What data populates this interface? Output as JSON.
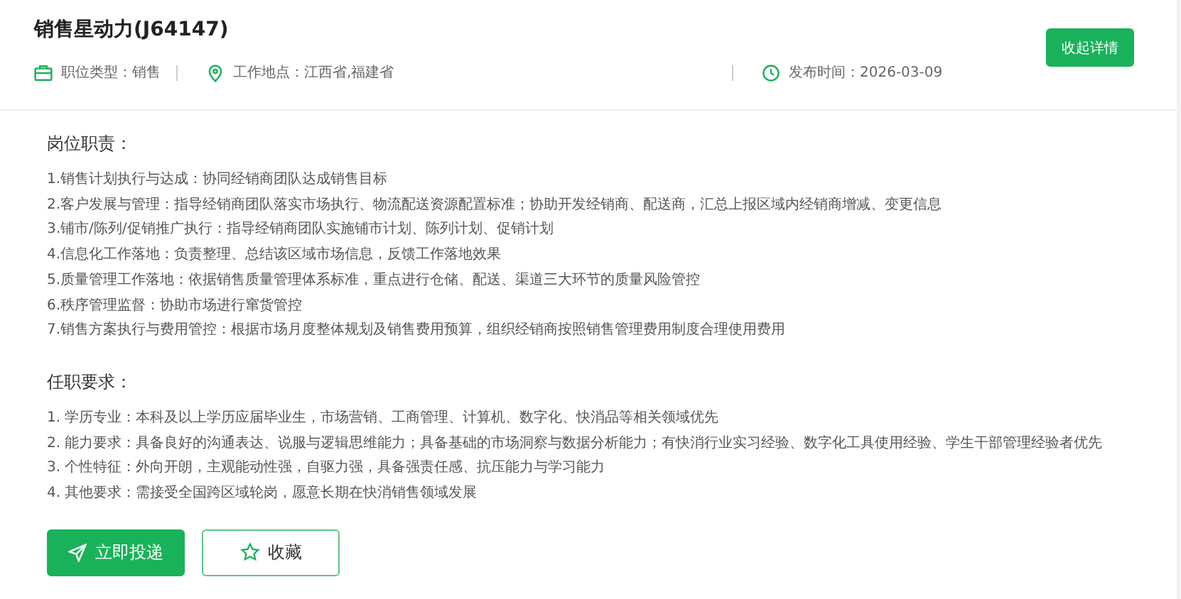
{
  "job": {
    "title": "销售星动力(J64147)",
    "collapse_button": "收起详情",
    "meta": [
      {
        "kind": "category",
        "text": "职位类型：销售"
      },
      {
        "kind": "location",
        "text": "工作地点：江西省,福建省"
      },
      {
        "kind": "date",
        "text": "发布时间：2026-03-09"
      }
    ]
  },
  "sections": [
    {
      "heading": "岗位职责：",
      "items": [
        "1.销售计划执行与达成：协同经销商团队达成销售目标",
        "2.客户发展与管理：指导经销商团队落实市场执行、物流配送资源配置标准；协助开发经销商、配送商，汇总上报区域内经销商增减、变更信息",
        "3.铺市/陈列/促销推广执行：指导经销商团队实施铺市计划、陈列计划、促销计划",
        "4.信息化工作落地：负责整理、总结该区域市场信息，反馈工作落地效果",
        "5.质量管理工作落地：依据销售质量管理体系标准，重点进行仓储、配送、渠道三大环节的质量风险管控",
        "6.秩序管理监督：协助市场进行窜货管控",
        "7.销售方案执行与费用管控：根据市场月度整体规划及销售费用预算，组织经销商按照销售管理费用制度合理使用费用"
      ]
    },
    {
      "heading": "任职要求：",
      "items": [
        "1. 学历专业：本科及以上学历应届毕业生，市场营销、工商管理、计算机、数字化、快消品等相关领域优先",
        "2. 能力要求：具备良好的沟通表达、说服与逻辑思维能力；具备基础的市场洞察与数据分析能力；有快消行业实习经验、数字化工具使用经验、学生干部管理经验者优先",
        "3. 个性特征：外向开朗，主观能动性强，自驱力强，具备强责任感、抗压能力与学习能力",
        "4. 其他要求：需接受全国跨区域轮岗，愿意长期在快消销售领域发展"
      ]
    }
  ],
  "actions": [
    {
      "kind": "apply",
      "label": "立即投递"
    },
    {
      "kind": "favorite",
      "label": "收藏"
    }
  ]
}
